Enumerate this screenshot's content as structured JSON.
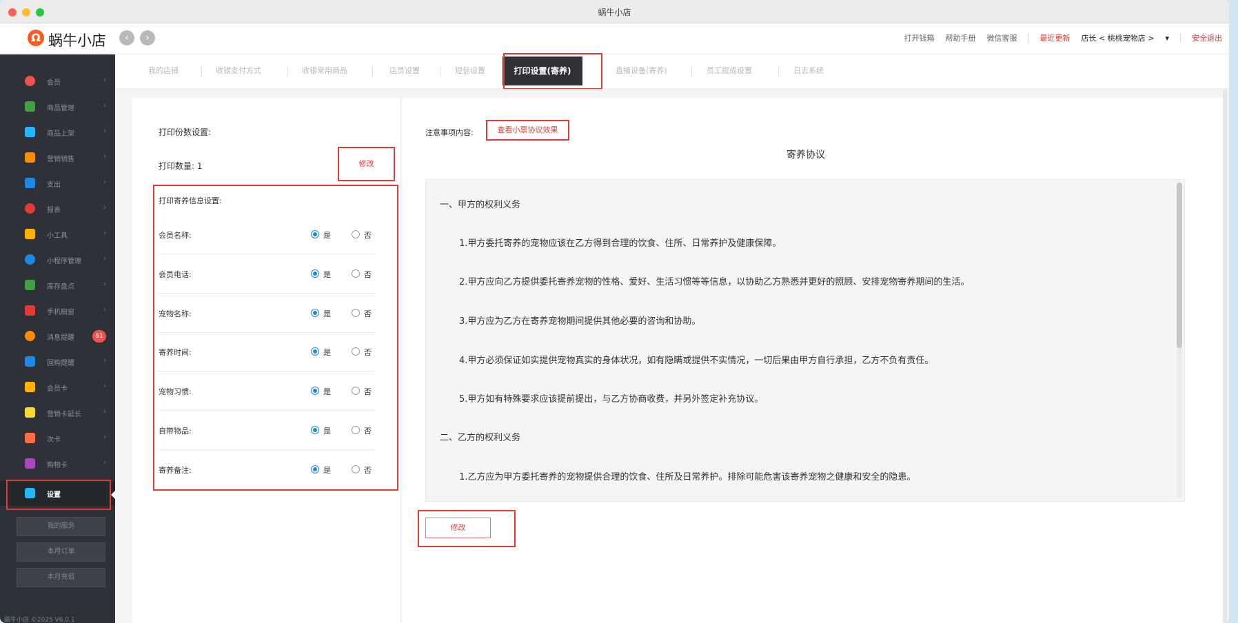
{
  "window": {
    "title": "蜗牛小店"
  },
  "brand": {
    "logo_char": "Ω",
    "name": "蜗牛小店"
  },
  "topbar": {
    "links": [
      "打开钱箱",
      "帮助手册",
      "微信客服"
    ],
    "latest_update": "最近更新",
    "store": "店长 < 桃桃宠物店 >",
    "dropdown_icon": "▾",
    "logout": "安全退出"
  },
  "sidebar": {
    "items": [
      {
        "label": "会员",
        "color": "#ef5350"
      },
      {
        "label": "商品管理",
        "color": "#43a047"
      },
      {
        "label": "商品上架",
        "color": "#29b6f6"
      },
      {
        "label": "营销销售",
        "color": "#fb8c00"
      },
      {
        "label": "支出",
        "color": "#1e88e5"
      },
      {
        "label": "报表",
        "color": "#e53935"
      },
      {
        "label": "小工具",
        "color": "#ffb300"
      },
      {
        "label": "小程序管理",
        "color": "#1e88e5"
      },
      {
        "label": "库存盘点",
        "color": "#43a047"
      },
      {
        "label": "手机橱窗",
        "color": "#e53935"
      },
      {
        "label": "消息提醒",
        "color": "#fb8c00",
        "badge": "61"
      },
      {
        "label": "回购提醒",
        "color": "#1e88e5"
      },
      {
        "label": "会员卡",
        "color": "#ffb300"
      },
      {
        "label": "营销卡延长",
        "color": "#fdd835"
      },
      {
        "label": "次卡",
        "color": "#ff7043"
      },
      {
        "label": "购物卡",
        "color": "#ab47bc"
      },
      {
        "label": "设置",
        "color": "#29b6f6",
        "active": true
      }
    ],
    "buttons": [
      "我的服务",
      "本月订单",
      "本月充值"
    ],
    "footer": "蜗牛小店 ©2025 V6.0.1"
  },
  "tabs": {
    "items": [
      "我的店铺",
      "收银支付方式",
      "收银常用商品",
      "店员设置",
      "短信设置"
    ],
    "active": "打印设置(寄养)",
    "after": [
      "直播设备(寄养)",
      "员工提成设置",
      "日志系统"
    ]
  },
  "left_panel": {
    "copies_title": "打印份数设置:",
    "quantity_label": "打印数量:  1",
    "edit_label": "修改",
    "info_title": "打印寄养信息设置:",
    "yes_label": "是",
    "no_label": "否",
    "rows": [
      {
        "label": "会员名称:",
        "selected": "是"
      },
      {
        "label": "会员电话:",
        "selected": "是"
      },
      {
        "label": "宠物名称:",
        "selected": "是"
      },
      {
        "label": "寄养时间:",
        "selected": "是"
      },
      {
        "label": "宠物习惯:",
        "selected": "是"
      },
      {
        "label": "自带物品:",
        "selected": "是"
      },
      {
        "label": "寄养备注:",
        "selected": "是"
      }
    ]
  },
  "right_panel": {
    "note_label": "注意事项内容:",
    "preview_link": "查看小票协议效果",
    "doc_title": "寄养协议",
    "agreement": {
      "section1": "一、甲方的权利义务",
      "item1": "1.甲方委托寄养的宠物应该在乙方得到合理的饮食、住所、日常养护及健康保障。",
      "item2": "2.甲方应向乙方提供委托寄养宠物的性格、爱好、生活习惯等等信息，以协助乙方熟悉并更好的照顾、安排宠物寄养期间的生活。",
      "item3": "3.甲方应为乙方在寄养宠物期间提供其他必要的咨询和协助。",
      "item4": "4.甲方必须保证如实提供宠物真实的身体状况，如有隐瞒或提供不实情况，一切后果由甲方自行承担，乙方不负有责任。",
      "item5": "5.甲方如有特殊要求应该提前提出，与乙方协商收费，并另外签定补充协议。",
      "section2": "二、乙方的权利义务",
      "item6": "1.乙方应为甲方委托寄养的宠物提供合理的饮食、住所及日常养护。排除可能危害该寄养宠物之健康和安全的隐患。"
    },
    "edit_label": "修改"
  },
  "colors": {
    "accent_red": "#e53935",
    "sidebar_bg": "#2e3238",
    "radio_blue": "#1e88e5"
  }
}
